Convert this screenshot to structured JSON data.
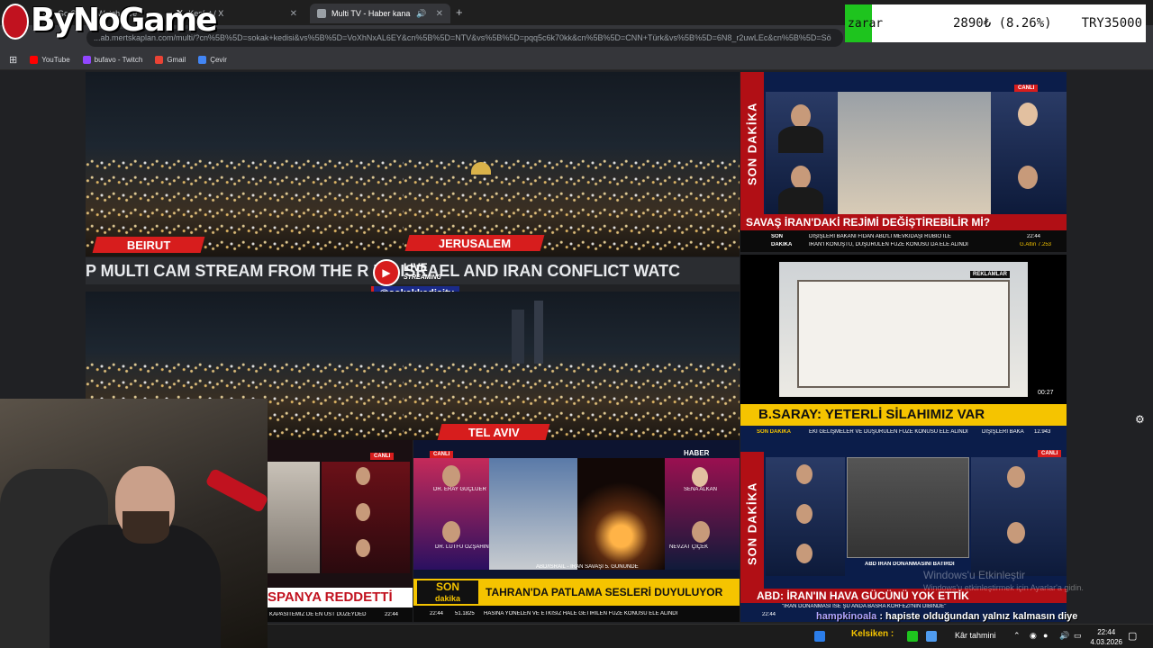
{
  "browser": {
    "tabs": [
      {
        "label": "Go Stre"
      },
      {
        "label": "Watch Live"
      },
      {
        "label": "Keşfet / X"
      },
      {
        "label": "Multi TV - Haber kanalları"
      }
    ],
    "url": "...ab.mertskaplan.com/multi/?cn%5B%5D=sokak+kedisi&vs%5B%5D=VoXhNxAL6EY&cn%5B%5D=NTV&vs%5B%5D=pqq5c6k70kk&cn%5B%5D=CNN+Türk&vs%5B%5D=6N8_r2uwLEc&cn%5B%5D=Sö",
    "bookmarks": [
      {
        "label": "YouTube",
        "color": "#ff0000"
      },
      {
        "label": "bufavo - Twitch",
        "color": "#9146ff"
      },
      {
        "label": "Gmail",
        "color": "#ea4335"
      },
      {
        "label": "Çevir",
        "color": "#4285f4"
      }
    ]
  },
  "overlay": {
    "logo": "ByNoGame",
    "ticker": {
      "label": "zarar",
      "change": "2890₺ (8.26%)",
      "target": "TRY35000",
      "accent": "#1ec41e"
    },
    "chat": {
      "user": "hampkinoala",
      "message": ": hapiste olduğundan yalnız kalmasın diye"
    },
    "watermark": {
      "title": "Windows'u Etkinleştir",
      "sub": "Windows'u etkinleştirmek için Ayarlar'a gidin."
    }
  },
  "stream": {
    "marquee": "P MULTI CAM STREAM FROM THE R    US ISRAEL AND IRAN CONFLICT WATC",
    "live": "LIVE",
    "streaming": "STREAMING",
    "handle": "@sokakkedisitv",
    "cities": [
      "BEIRUT",
      "JERUSALEM",
      "TEL AVIV"
    ]
  },
  "news": {
    "ntv": {
      "vertical": "SON DAKİKA",
      "canli": "CANLI",
      "headline": "SAVAŞ İRAN'DAKİ REJİMİ DEĞİŞTİREBİLİR Mİ?",
      "son": "SON",
      "dakika": "DAKİKA",
      "line1": "DIŞİŞLERİ BAKANI FİDAN ABD'Lİ MEVKİDAŞI RUBIO İLE",
      "line2": "İRAN'I KONUŞTU, DÜŞÜRÜLEN FÜZE KONUSU DA ELE ALINDI",
      "time": "22:44",
      "gold": "G.Altın 7.253"
    },
    "ad": {
      "tag": "REKLAMLAR",
      "time": "00:27",
      "headline": "B.SARAY: YETERLİ SİLAHIMIZ VAR",
      "son": "SON DAKİKA",
      "sub": "EKİ GELİŞMELER VE DÜŞÜRÜLEN FÜZE KONUSU ELE ALINDI",
      "sub2": "DIŞİŞLERİ BAKA",
      "val": "12.943"
    },
    "spanya": {
      "canli": "CANLI",
      "headline": "SPANYA REDDETTİ",
      "sub": "KAPASİTEMİZ DE EN ÜST DÜZEYDEDİR",
      "time": "22:44"
    },
    "center": {
      "canli": "CANLI",
      "haber": "HABER",
      "son": "SON",
      "dakika": "dakika",
      "headline": "TAHRAN'DA PATLAMA SESLERİ DUYULUYOR",
      "time": "22:44",
      "val": "51.1825",
      "sub": "HASINA YÖNELEN VE ETKİSİZ HALE GETİRİLEN FÜZE KONUSU ELE ALINDI",
      "caption": "ABD/İSRAİL - İRAN SAVAŞI 5. GÜNÜNDE",
      "names": [
        "DR. ERAY GÜÇLÜER",
        "DR. LÜTFÜ ÖZŞAHİN",
        "SENA ALKAN",
        "NEVZAT ÇİÇEK"
      ]
    },
    "halk": {
      "canli": "CANLI",
      "vertical": "SON DAKİKA",
      "headline": "ABD: İRAN'IN HAVA GÜCÜNÜ YOK ETTİK",
      "sub": "\"İRAN DONANMASI İSE ŞU ANDA BASRA KÖRFEZİ'NİN DİBİNDE\"",
      "caption": "ABD İRAN DONANMASINI BATIRDI",
      "time": "22:44"
    }
  },
  "taskbar": {
    "app": "Kelsiken :",
    "weather": "Kâr tahmini",
    "time": "22:44",
    "date": "4.03.2026"
  }
}
